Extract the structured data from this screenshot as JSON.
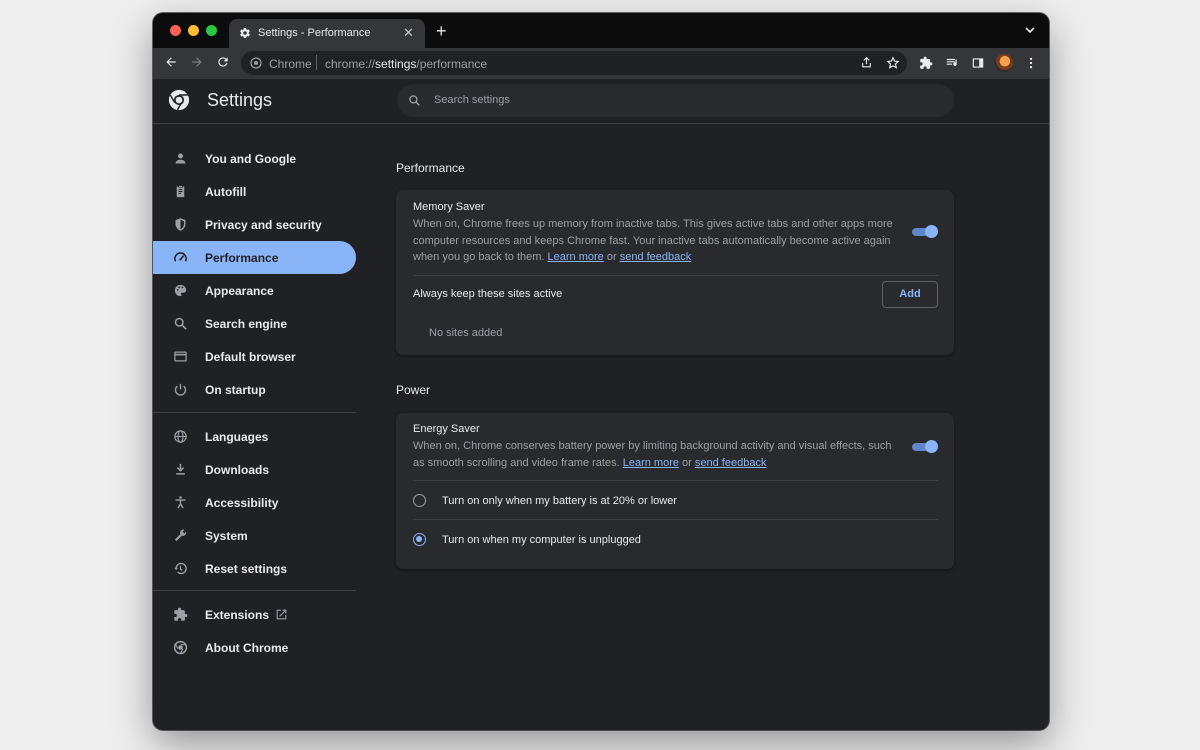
{
  "window": {
    "traffic_lights": {
      "close": "#ff5f57",
      "minimize": "#febc2e",
      "zoom": "#28c840"
    },
    "tab": {
      "title": "Settings - Performance",
      "icon": "gear-icon",
      "close_glyph": "✕"
    },
    "new_tab_glyph": "+",
    "tab_list_icon": "chevron-down-icon"
  },
  "toolbar": {
    "omnibox": {
      "chip": "Chrome",
      "url_prefix": "chrome://",
      "url_host": "settings",
      "url_path": "/performance"
    },
    "icons": [
      "back-icon",
      "forward-icon",
      "reload-icon",
      "share-icon",
      "star-icon",
      "extensions-icon",
      "reading-list-icon",
      "side-panel-icon",
      "avatar",
      "more-icon"
    ]
  },
  "header": {
    "title": "Settings",
    "search_placeholder": "Search settings"
  },
  "sidebar": {
    "items": [
      {
        "label": "You and Google",
        "icon": "person-icon"
      },
      {
        "label": "Autofill",
        "icon": "clipboard-icon"
      },
      {
        "label": "Privacy and security",
        "icon": "shield-icon"
      },
      {
        "label": "Performance",
        "icon": "speedometer-icon",
        "selected": true
      },
      {
        "label": "Appearance",
        "icon": "palette-icon"
      },
      {
        "label": "Search engine",
        "icon": "search-icon"
      },
      {
        "label": "Default browser",
        "icon": "browser-icon"
      },
      {
        "label": "On startup",
        "icon": "power-icon"
      },
      {
        "label": "Languages",
        "icon": "globe-icon"
      },
      {
        "label": "Downloads",
        "icon": "download-icon"
      },
      {
        "label": "Accessibility",
        "icon": "accessibility-icon"
      },
      {
        "label": "System",
        "icon": "wrench-icon"
      },
      {
        "label": "Reset settings",
        "icon": "restore-icon"
      },
      {
        "label": "Extensions",
        "icon": "puzzle-icon"
      },
      {
        "label": "About Chrome",
        "icon": "chrome-icon"
      }
    ]
  },
  "performance": {
    "section_title": "Performance",
    "memory_saver": {
      "title": "Memory Saver",
      "description": "When on, Chrome frees up memory from inactive tabs. This gives active tabs and other apps more computer resources and keeps Chrome fast. Your inactive tabs automatically become active again when you go back to them.",
      "learn_more": "Learn more",
      "or": "or",
      "send_feedback": "send feedback",
      "enabled": true
    },
    "always_active": {
      "title": "Always keep these sites active",
      "add_label": "Add",
      "empty_text": "No sites added"
    }
  },
  "power": {
    "section_title": "Power",
    "energy_saver": {
      "title": "Energy Saver",
      "description": "When on, Chrome conserves battery power by limiting background activity and visual effects, such as smooth scrolling and video frame rates.",
      "learn_more": "Learn more",
      "or": "or",
      "send_feedback": "send feedback",
      "enabled": true
    },
    "options": [
      {
        "label": "Turn on only when my battery is at 20% or lower",
        "selected": false
      },
      {
        "label": "Turn on when my computer is unplugged",
        "selected": true
      }
    ]
  },
  "colors": {
    "accent": "#8ab4f8",
    "background": "#202124",
    "card": "#292a2d",
    "text": "#e8eaed",
    "secondary_text": "#9aa0a6"
  }
}
